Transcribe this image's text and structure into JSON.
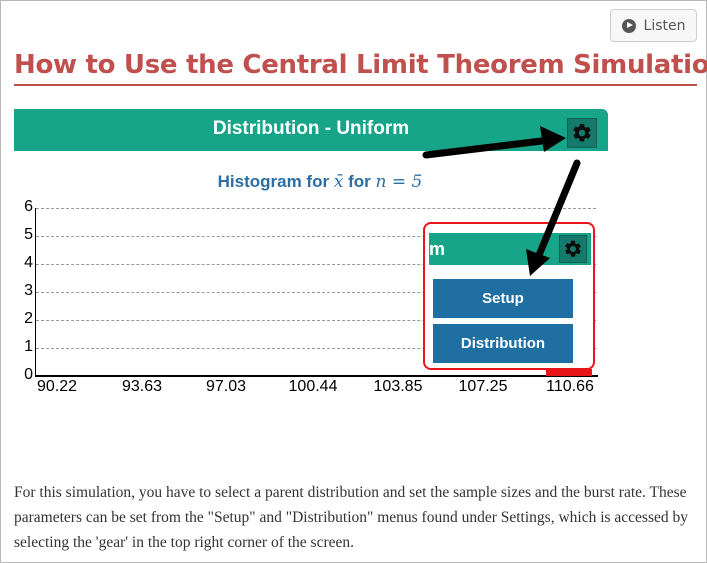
{
  "listen": {
    "label": "Listen",
    "icon": "play-circle-icon"
  },
  "page_title": "How to Use the Central Limit Theorem Simulation",
  "simulation": {
    "header_title": "Distribution - Uniform",
    "gear_icon": "gear-icon",
    "histogram": {
      "title_prefix": "Histogram for",
      "xbar_symbol": "x̄",
      "title_for": "for",
      "n_expr": "n = 5",
      "y_ticks": [
        "0",
        "1",
        "2",
        "3",
        "4",
        "5",
        "6"
      ],
      "x_ticks": [
        "90.22",
        "93.63",
        "97.03",
        "100.44",
        "103.85",
        "107.25",
        "110.66"
      ]
    }
  },
  "callout": {
    "header_fragment": "m",
    "gear_icon": "gear-icon",
    "menu": {
      "setup": "Setup",
      "distribution": "Distribution"
    }
  },
  "colors": {
    "title": "#c0504d",
    "header_bg": "#17a589",
    "menu_bg": "#1f6fa3",
    "highlight": "#e8151b",
    "arrow": "#000000"
  },
  "instructions": "For this simulation, you have to select a parent distribution and set the sample sizes and the burst rate. These parameters can be set from the \"Setup\" and \"Distribution\" menus found under Settings, which is accessed by selecting the 'gear' in the top right corner of the screen."
}
